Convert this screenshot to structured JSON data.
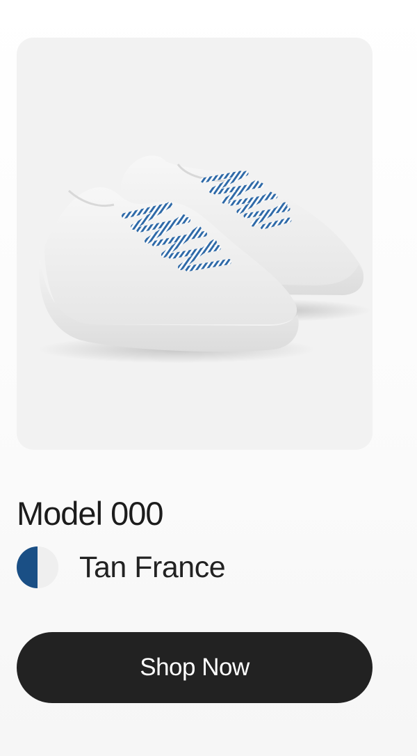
{
  "product": {
    "name": "Model 000",
    "image_icon": "white-knit-sneakers-pair"
  },
  "colorway": {
    "name": "Tan France",
    "swatch_colors": [
      "#1a4f85",
      "#efefef"
    ]
  },
  "cta": {
    "label": "Shop Now"
  },
  "colors": {
    "button_bg": "#222222",
    "button_text": "#ffffff",
    "image_bg": "#f2f2f2",
    "lace_blue": "#2f6aa8"
  }
}
